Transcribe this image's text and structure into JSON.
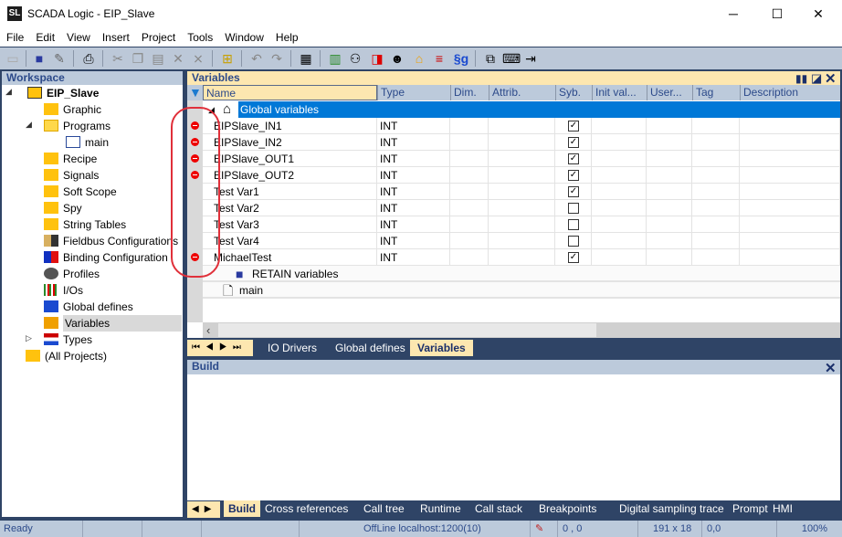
{
  "app": {
    "title": "SCADA Logic - EIP_Slave",
    "logo": "SL"
  },
  "window_controls": {
    "minimize": "─",
    "maximize": "☐",
    "close": "✕"
  },
  "menu": [
    "File",
    "Edit",
    "View",
    "Insert",
    "Project",
    "Tools",
    "Window",
    "Help"
  ],
  "workspace": {
    "title": "Workspace",
    "items": [
      {
        "label": "EIP_Slave",
        "icon": "project-icon",
        "level": 0,
        "expanded": true,
        "bold": true
      },
      {
        "label": "Graphic",
        "icon": "folder-icon",
        "level": 2
      },
      {
        "label": "Programs",
        "icon": "folder-open-icon",
        "level": 2,
        "expanded": true
      },
      {
        "label": "main",
        "icon": "st-file-icon",
        "level": 3
      },
      {
        "label": "Recipe",
        "icon": "folder-icon",
        "level": 2
      },
      {
        "label": "Signals",
        "icon": "folder-icon",
        "level": 2
      },
      {
        "label": "Soft Scope",
        "icon": "folder-icon",
        "level": 2
      },
      {
        "label": "Spy",
        "icon": "folder-icon",
        "level": 2
      },
      {
        "label": "String Tables",
        "icon": "folder-icon",
        "level": 2
      },
      {
        "label": "Fieldbus Configurations",
        "icon": "fieldbus-icon",
        "level": 2
      },
      {
        "label": "Binding Configuration",
        "icon": "binding-icon",
        "level": 2
      },
      {
        "label": "Profiles",
        "icon": "profile-icon",
        "level": 2
      },
      {
        "label": "I/Os",
        "icon": "io-icon",
        "level": 2
      },
      {
        "label": "Global defines",
        "icon": "defines-icon",
        "level": 2
      },
      {
        "label": "Variables",
        "icon": "variables-icon",
        "level": 2,
        "selected": true
      },
      {
        "label": "Types",
        "icon": "types-icon",
        "level": 2,
        "collapsed": true
      },
      {
        "label": "(All Projects)",
        "icon": "folder-icon",
        "level": 1
      }
    ]
  },
  "variables": {
    "title": "Variables",
    "columns": [
      "Name",
      "Type",
      "Dim.",
      "Attrib.",
      "Syb.",
      "Init val...",
      "User...",
      "Tag",
      "Description"
    ],
    "group": "Global variables",
    "rows": [
      {
        "name": "EIPSlave_IN1",
        "type": "INT",
        "syb": true,
        "error": true
      },
      {
        "name": "EIPSlave_IN2",
        "type": "INT",
        "syb": true,
        "error": true
      },
      {
        "name": "EIPSlave_OUT1",
        "type": "INT",
        "syb": true,
        "error": true
      },
      {
        "name": "EIPSlave_OUT2",
        "type": "INT",
        "syb": true,
        "error": true
      },
      {
        "name": "Test Var1",
        "type": "INT",
        "syb": true,
        "error": false
      },
      {
        "name": "Test Var2",
        "type": "INT",
        "syb": false,
        "error": false
      },
      {
        "name": "Test Var3",
        "type": "INT",
        "syb": false,
        "error": false
      },
      {
        "name": "Test Var4",
        "type": "INT",
        "syb": false,
        "error": false
      },
      {
        "name": "MichaelTest",
        "type": "INT",
        "syb": true,
        "error": true
      }
    ],
    "subgroups": [
      "RETAIN variables",
      "main"
    ],
    "tabs": [
      "IO Drivers",
      "Global defines",
      "Variables"
    ],
    "active_tab": "Variables"
  },
  "build": {
    "title": "Build",
    "close": "✕"
  },
  "output_tabs": [
    "Build",
    "Cross references",
    "Call tree",
    "Runtime",
    "Call stack",
    "Breakpoints",
    "Digital sampling trace",
    "Prompt",
    "HMI"
  ],
  "status": {
    "ready": "Ready",
    "connection": "OffLine  localhost:1200(10)",
    "position": "0 , 0",
    "size": "191 x 18",
    "coords": "0,0",
    "zoom": "100%"
  },
  "colors": {
    "navy": "#2f4466",
    "accent_selection": "#0078d7",
    "panel_header": "#bccadb",
    "active_header": "#fde7b0",
    "error": "#e00000",
    "annotation": "#e0303a"
  }
}
